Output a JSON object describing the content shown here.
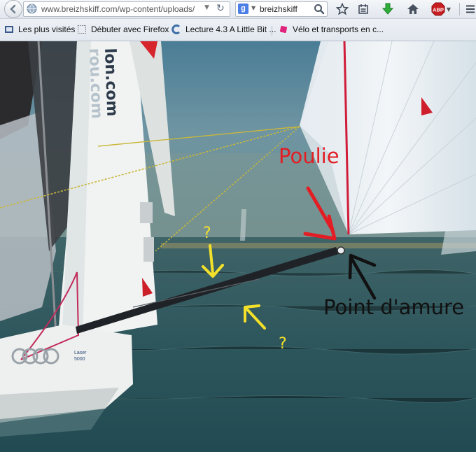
{
  "browser": {
    "url": "www.breizhskiff.com/wp-content/uploads/",
    "search_engine_icon": "google-g-icon",
    "search_text": "breizhskiff",
    "toolbar_icons": [
      "star-icon",
      "reading-list-icon",
      "download-arrow-icon",
      "home-icon",
      "adblock-icon",
      "menu-icon"
    ],
    "adblock_label": "ABP"
  },
  "bookmarks": {
    "items": [
      {
        "label": "Les plus visités",
        "icon": "bookmarks-menu-icon"
      },
      {
        "label": "Débuter avec Firefox",
        "icon": "dotted-page-icon"
      },
      {
        "label": "Lecture 4.3 A Little Bit ...",
        "icon": "coursera-c-icon"
      },
      {
        "label": "Vélo et transports en c...",
        "icon": "pink-diamond-icon"
      }
    ]
  },
  "image": {
    "annotations": {
      "poulie": "Poulie",
      "point_amure": "Point d'amure",
      "question_1": "?",
      "question_2": "?"
    },
    "colors": {
      "red": "#e31d24",
      "yellow": "#f3e02b",
      "black": "#111111",
      "sea": "#2f5660"
    },
    "hull_text": {
      "sail_text": "lon.com",
      "sail_text2": "rou.com",
      "brand_rings": "audi-rings",
      "hull_label_1": "Laser",
      "hull_label_2": "5000"
    }
  }
}
